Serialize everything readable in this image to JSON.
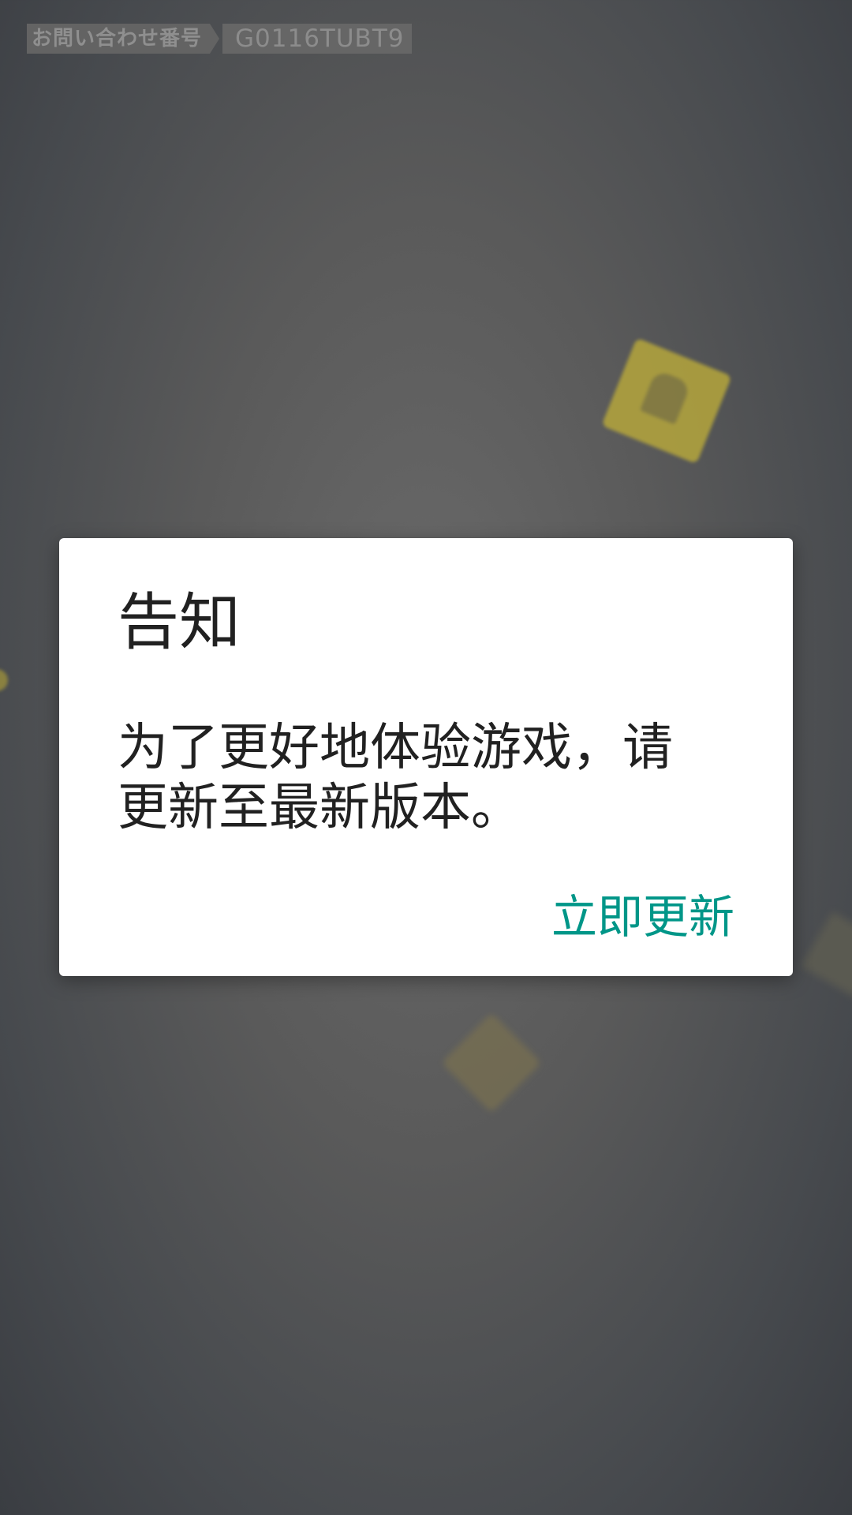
{
  "inquiry": {
    "label": "お問い合わせ番号",
    "code": "G0116TUBT9"
  },
  "dialog": {
    "title": "告知",
    "message": "为了更好地体验游戏，请更新至最新版本。",
    "update_button": "立即更新"
  },
  "colors": {
    "accent": "#009688",
    "dialog_background": "#ffffff",
    "text": "#212121",
    "scrim": "#5a5a5a"
  }
}
